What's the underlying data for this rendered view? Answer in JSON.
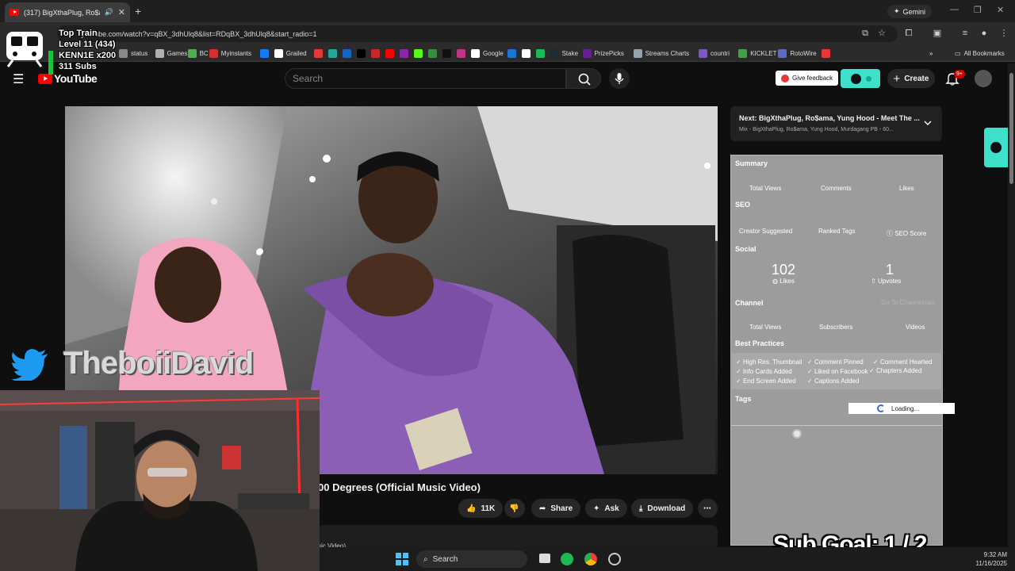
{
  "browser": {
    "tab_title": "(317) BigXthaPlug, Ro$ama,",
    "new_tab": "+",
    "gemini_label": "Gemini",
    "url": "youtube.com/watch?v=qBX_3dhUlq8&list=RDqBX_3dhUlq8&start_radio=1",
    "bookmarks": [
      {
        "label": "status",
        "color": "#888888"
      },
      {
        "label": "Games",
        "color": "#b0b0b0"
      },
      {
        "label": "BC",
        "color": "#4caf50"
      },
      {
        "label": "Myinstants",
        "color": "#d32f2f"
      },
      {
        "label": "",
        "color": "#1877f2"
      },
      {
        "label": "Grailed",
        "color": "#ffffff"
      },
      {
        "label": "",
        "color": "#e53935"
      },
      {
        "label": "",
        "color": "#26a69a"
      },
      {
        "label": "",
        "color": "#1565c0"
      },
      {
        "label": "",
        "color": "#000000"
      },
      {
        "label": "",
        "color": "#c62828"
      },
      {
        "label": "",
        "color": "#ff0000"
      },
      {
        "label": "",
        "color": "#8e24aa"
      },
      {
        "label": "",
        "color": "#53fc18"
      },
      {
        "label": "",
        "color": "#388e3c"
      },
      {
        "label": "",
        "color": "#111111"
      },
      {
        "label": "",
        "color": "#c13584"
      },
      {
        "label": "Google",
        "color": "#ffffff"
      },
      {
        "label": "",
        "color": "#1976d2"
      },
      {
        "label": "",
        "color": "#ffffff"
      },
      {
        "label": "",
        "color": "#1db954"
      },
      {
        "label": "Stake",
        "color": "#1a2c38"
      },
      {
        "label": "PrizePicks",
        "color": "#6a1b9a"
      },
      {
        "label": "Streams Charts",
        "color": "#90a4ae"
      },
      {
        "label": "countri",
        "color": "#7e57c2"
      },
      {
        "label": "KICKLET",
        "color": "#43a047"
      },
      {
        "label": "RotoWire",
        "color": "#5c6bc0"
      },
      {
        "label": "",
        "color": "#e53935"
      }
    ],
    "bookmarks_more": "»",
    "all_bookmarks": "All Bookmarks"
  },
  "youtube": {
    "logo_text": "YouTube",
    "search_placeholder": "Search",
    "give_feedback": "Give feedback",
    "create_label": "Create",
    "notification_count": "9+",
    "video_title_visible": "00 Degrees (Official Music Video)",
    "like_count": "11K",
    "share_label": "Share",
    "ask_label": "Ask",
    "download_label": "Download",
    "description_snippet": "sic Video)"
  },
  "up_next": {
    "title": "Next: BigXthaPlug, Ro$ama, Yung Hood - Meet The ...",
    "subtitle": "Mix - BigXthaPlug, Ro$ama, Yung Hood, Murdagang PB - 60..."
  },
  "panel": {
    "summary": "Summary",
    "summary_cols": [
      "Total Views",
      "Comments",
      "Likes"
    ],
    "seo": "SEO",
    "seo_cols": [
      "Creator Suggested",
      "Ranked Tags",
      "SEO Score"
    ],
    "social": "Social",
    "likes_value": "102",
    "likes_label": "Likes",
    "upvotes_value": "1",
    "upvotes_label": "Upvotes",
    "channel": "Channel",
    "channel_link": "Go To Channelmax",
    "channel_cols": [
      "Total Views",
      "Subscribers",
      "Videos"
    ],
    "best_practices": "Best Practices",
    "practices": [
      "High Res. Thumbnail",
      "Comment Pinned",
      "Comment Hearted",
      "Info Cards Added",
      "Liked on Facebook",
      "Chapters Added",
      "End Screen Added",
      "Captions Added"
    ],
    "tags": "Tags",
    "loading": "Loading..."
  },
  "overlay": {
    "train_title": "Top Train",
    "train_level": "Level 11  (434)",
    "train_user": "KENN1E x200",
    "train_subs": "311 Subs",
    "twitter_handle": "TheboiiDavid",
    "sub_goal": "Sub Goal:  1 / 2"
  },
  "taskbar": {
    "search_label": "Search",
    "time": "9:32 AM",
    "date": "11/16/2025"
  }
}
